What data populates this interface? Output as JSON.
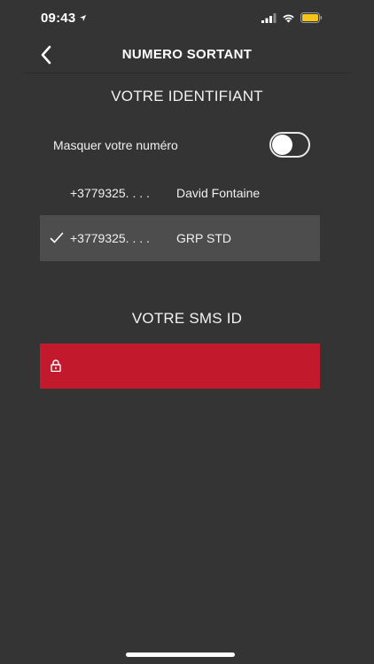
{
  "status_bar": {
    "time": "09:43",
    "icons": [
      "location-arrow-icon",
      "signal-icon",
      "wifi-icon",
      "battery-icon"
    ],
    "battery_color": "#f5c518"
  },
  "nav": {
    "title": "NUMERO SORTANT",
    "back_icon": "chevron-left-icon"
  },
  "identifiant": {
    "title": "VOTRE IDENTIFIANT",
    "mask_label": "Masquer votre numéro",
    "mask_enabled": false,
    "rows": [
      {
        "number": "+3779325. . . .",
        "name": "David Fontaine",
        "selected": false
      },
      {
        "number": "+3779325. . . .",
        "name": "GRP STD",
        "selected": true
      }
    ]
  },
  "sms": {
    "title": "VOTRE SMS ID",
    "field_color": "#c3192c",
    "lock_icon": "lock-icon"
  },
  "colors": {
    "background": "#343434",
    "selected_row": "#4d4d4d",
    "accent_red": "#c3192c"
  }
}
